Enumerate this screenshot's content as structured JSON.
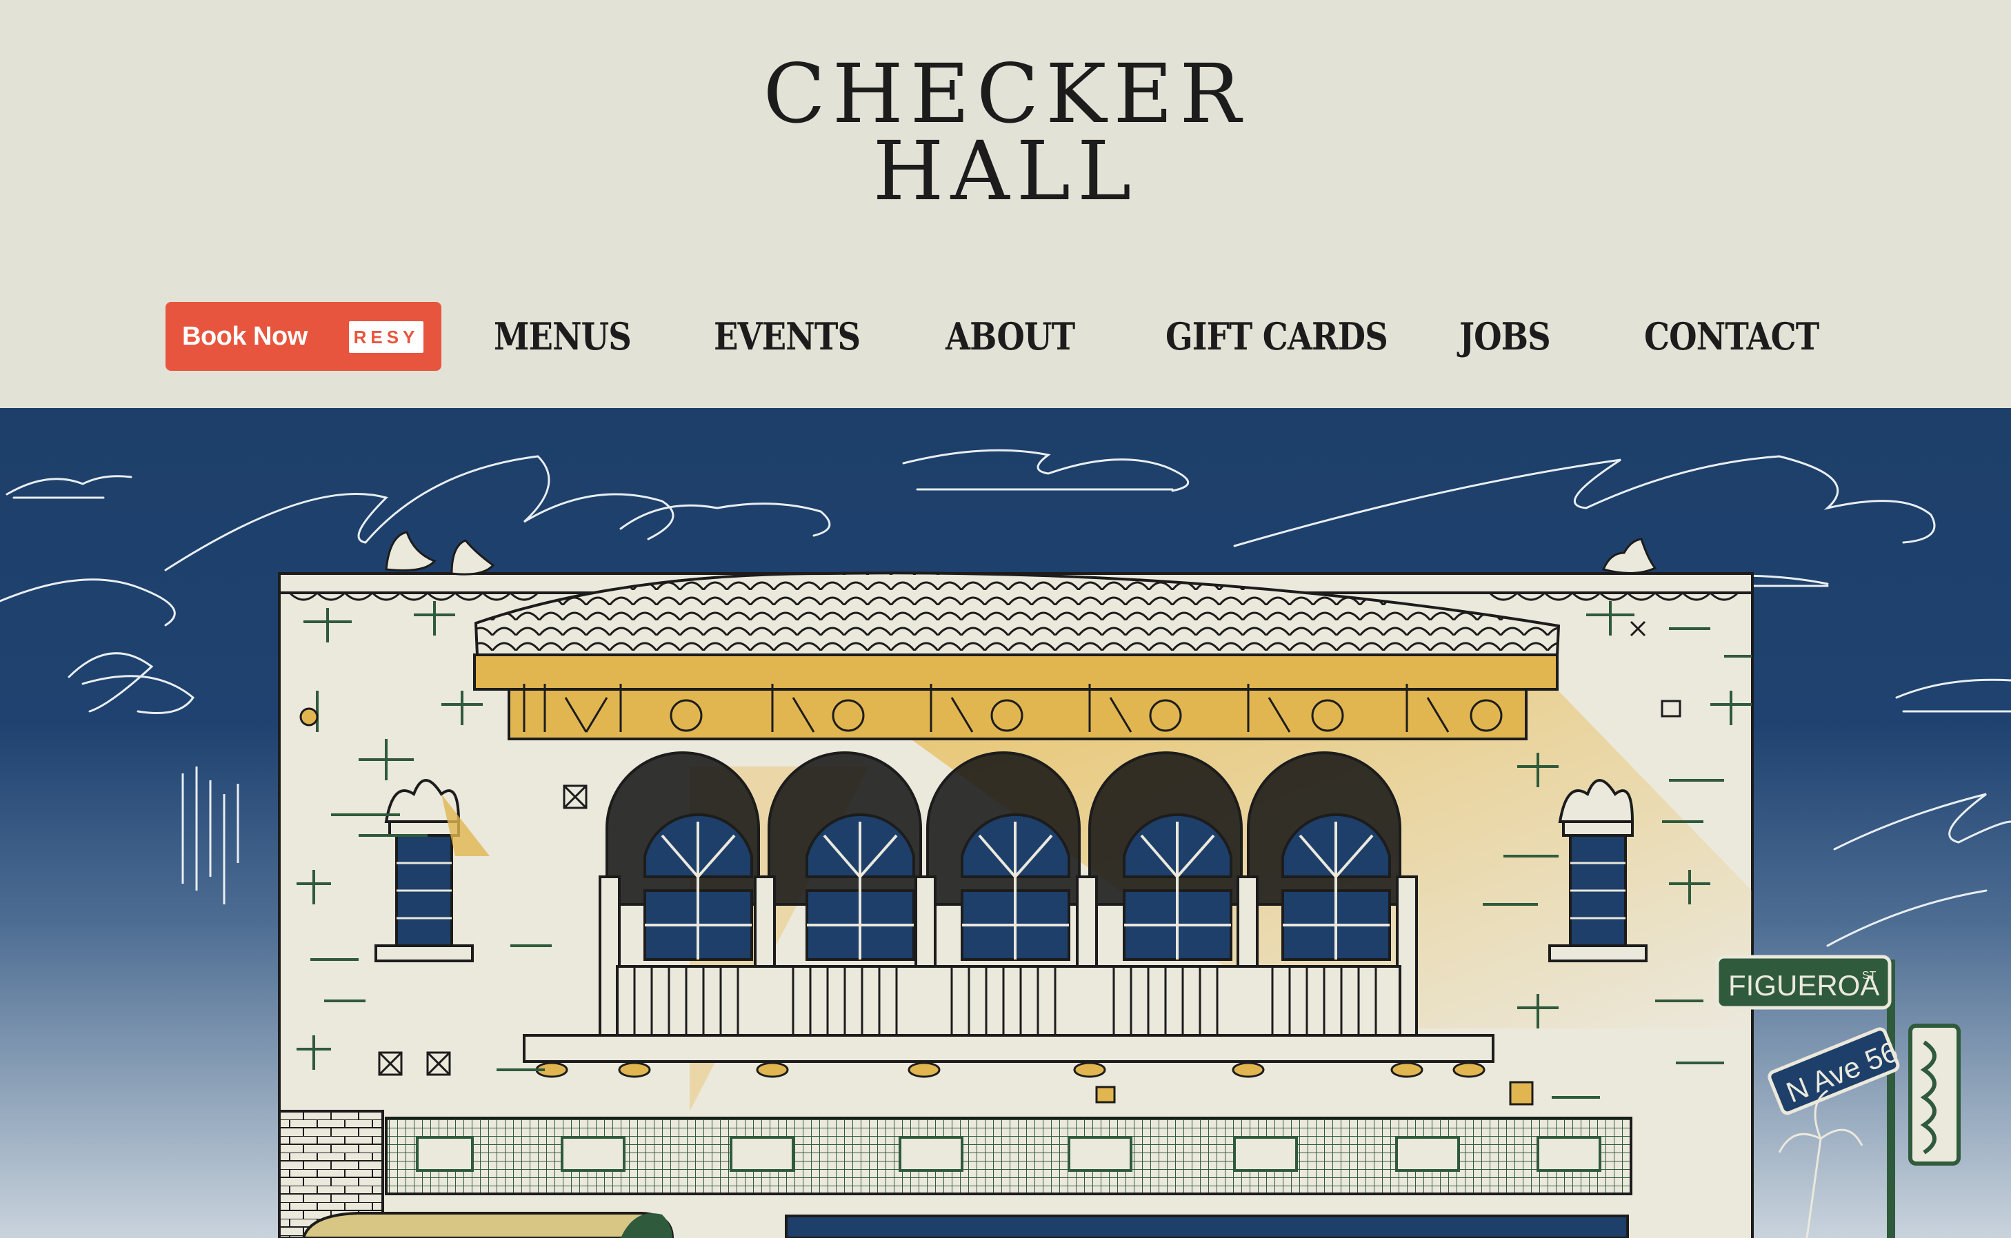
{
  "brand": {
    "name_line1": "CHECKER",
    "name_line2": "HALL"
  },
  "nav": {
    "book_now": "Book Now",
    "resy_badge": "RESY",
    "items": [
      {
        "label": "MENUS"
      },
      {
        "label": "EVENTS"
      },
      {
        "label": "ABOUT"
      },
      {
        "label": "GIFT CARDS"
      },
      {
        "label": "JOBS"
      },
      {
        "label": "CONTACT"
      }
    ]
  },
  "hero": {
    "street_sign_1": "FIGUEROA",
    "street_sign_1_suffix": "ST",
    "street_sign_2": "N Ave 56"
  },
  "colors": {
    "background": "#e2e2d6",
    "book_button": "#e8553e",
    "sky": "#1d3f69",
    "building": "#ebe8dc",
    "gold": "#e1b650",
    "green": "#2f5a3c"
  }
}
